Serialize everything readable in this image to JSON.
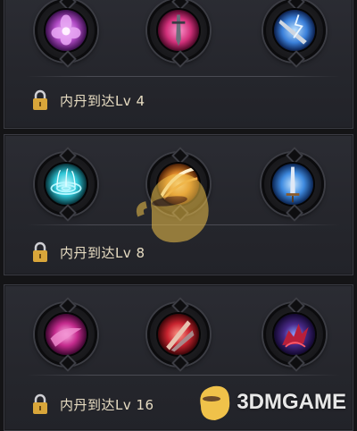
{
  "rows": [
    {
      "unlock_text": "内丹到达Lv 4",
      "skills": [
        {
          "icon": "purple-flower-icon",
          "color": "#b14bc6"
        },
        {
          "icon": "pink-sword-icon",
          "color": "#d1307a"
        },
        {
          "icon": "blue-lightning-blade-icon",
          "color": "#3a7fd9"
        }
      ]
    },
    {
      "unlock_text": "内丹到达Lv 8",
      "skills": [
        {
          "icon": "blue-ripple-icon",
          "color": "#2ec6d6"
        },
        {
          "icon": "orange-slash-icon",
          "color": "#e0892a"
        },
        {
          "icon": "blue-sword-icon",
          "color": "#3f8be0"
        }
      ]
    },
    {
      "unlock_text": "内丹到达Lv 16",
      "skills": [
        {
          "icon": "magenta-swirl-icon",
          "color": "#c42b8d"
        },
        {
          "icon": "red-blades-icon",
          "color": "#c8242f"
        },
        {
          "icon": "crimson-dragon-icon",
          "color": "#b81f3a"
        }
      ]
    }
  ],
  "watermark": {
    "text": "3DMGAME"
  }
}
